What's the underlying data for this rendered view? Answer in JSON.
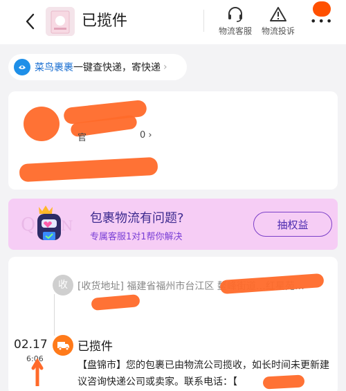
{
  "header": {
    "title": "已揽件",
    "actions": [
      {
        "label": "物流客服",
        "icon": "headset-icon"
      },
      {
        "label": "物流投诉",
        "icon": "warning-icon"
      }
    ],
    "more_icon": "more-icon"
  },
  "cainiao": {
    "brand": "菜鸟裹裹",
    "text": "一键查快递，寄快递",
    "arrow": "›"
  },
  "shipment_card": {
    "partial_text": "官",
    "partial_suffix": "0 ›"
  },
  "rights_banner": {
    "title": "包裹物流有问题?",
    "subtitle": "专属客服1对1帮你解决",
    "button": "抽权益"
  },
  "timeline": {
    "receiver": {
      "badge": "收",
      "address": "[收货地址] 福建省福州市台江区 鳌峰街道…红星苑…"
    },
    "events": [
      {
        "date": "02.17",
        "time": "6:06",
        "title": "已揽件",
        "description": "【盘锦市】您的包裹已由物流公司揽收，如长时间未更新建议咨询快递公司或卖家。联系电话：【"
      }
    ]
  },
  "colors": {
    "accent": "#ff5000",
    "banner_bg": "#f6cdf5",
    "cainiao_blue": "#1e8fe8",
    "redaction": "#ff6a2a"
  }
}
